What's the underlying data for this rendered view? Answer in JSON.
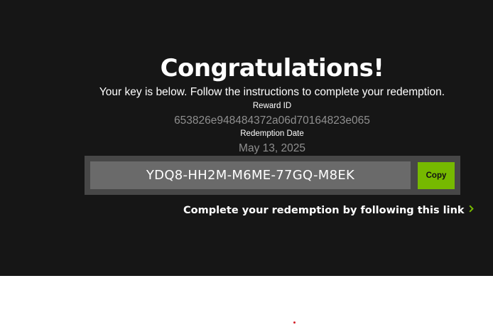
{
  "hero": {
    "title": "Congratulations!",
    "subtitle": "Your key is below. Follow the instructions to complete your redemption.",
    "reward_id_label": "Reward ID",
    "reward_id_value": "653826e948484372a06d70164823e065",
    "redemption_date_label": "Redemption Date",
    "redemption_date_value": "May 13, 2025",
    "key": "YDQ8-HH2M-M6ME-77GQ-M8EK",
    "copy_label": "Copy",
    "link_label": "Complete your redemption by following this link"
  },
  "colors": {
    "background_dark": "#161616",
    "accent_green": "#76b900",
    "key_panel": "#474747",
    "key_box": "#6a6a6a",
    "muted_text": "#8f8f8f"
  },
  "icons": {
    "link_chevron": "chevron-right-icon"
  }
}
